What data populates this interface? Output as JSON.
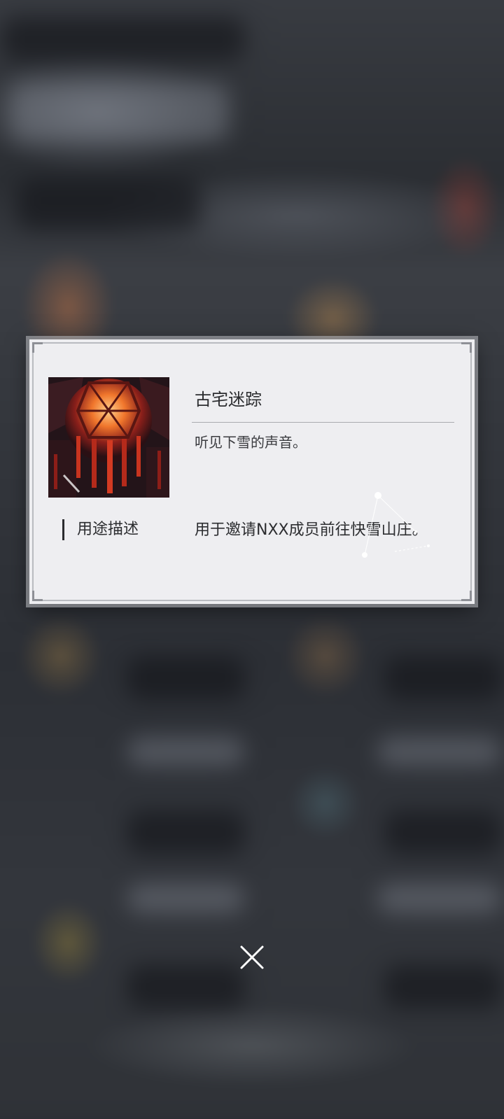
{
  "popup": {
    "item_name": "古宅迷踪",
    "flavor_text": "听见下雪的声音。",
    "usage_label": "用途描述",
    "usage_text": "用于邀请NXX成员前往快雪山庄。"
  },
  "icons": {
    "close": "close-icon",
    "item_image": "red-lantern-image",
    "decoration": "constellation-decoration"
  },
  "colors": {
    "card_background": "#eeeef1",
    "text": "#2c2d30",
    "lantern_red": "#c8341f"
  }
}
